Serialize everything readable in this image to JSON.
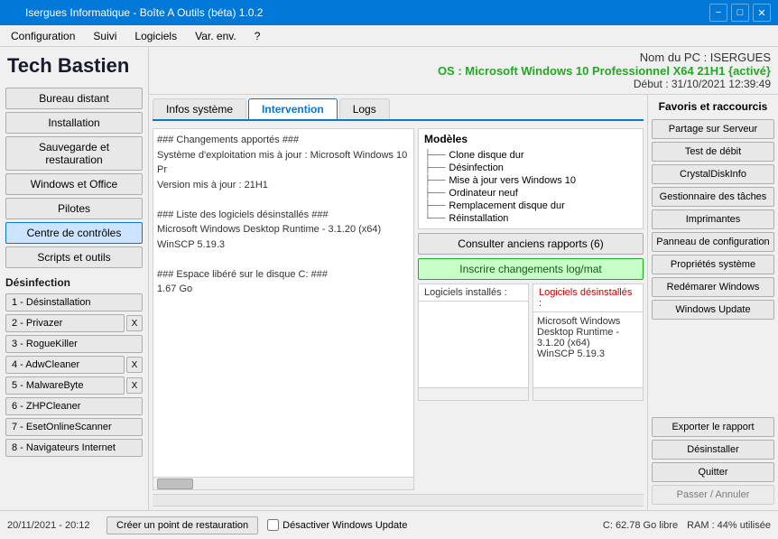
{
  "titlebar": {
    "title": "Isergues Informatique - Boîte A Outils (béta) 1.0.2",
    "minimize": "−",
    "maximize": "□",
    "close": "✕"
  },
  "menubar": {
    "items": [
      "Configuration",
      "Suivi",
      "Logiciels",
      "Var. env.",
      "?"
    ]
  },
  "header": {
    "pc_name": "Nom du PC : ISERGUES",
    "os": "OS : Microsoft Windows 10 Professionnel X64 21H1 {activé}",
    "date": "Début : 31/10/2021 12:39:49"
  },
  "sidebar": {
    "app_title": "Tech Bastien",
    "buttons": [
      "Bureau distant",
      "Installation",
      "Sauvegarde et restauration",
      "Windows et Office",
      "Pilotes"
    ],
    "active_button": "Centre de contrôles",
    "scripts_btn": "Scripts et outils",
    "desinfection_title": "Désinfection",
    "desinfection_items": [
      {
        "label": "1 - Désinstallation",
        "has_x": false
      },
      {
        "label": "2 - Privazer",
        "has_x": true
      },
      {
        "label": "3 - RogueKiller",
        "has_x": false
      },
      {
        "label": "4 - AdwCleaner",
        "has_x": true
      },
      {
        "label": "5 - MalwareByte",
        "has_x": true
      },
      {
        "label": "6 - ZHPCleaner",
        "has_x": false
      },
      {
        "label": "7 - EsetOnlineScanner",
        "has_x": false
      },
      {
        "label": "8 - Navigateurs Internet",
        "has_x": false
      }
    ]
  },
  "tabs": {
    "items": [
      "Infos système",
      "Intervention",
      "Logs"
    ],
    "active": "Intervention"
  },
  "intervention": {
    "changes_content": "### Changements apportés ###\nSystème d'exploitation mis à jour : Microsoft Windows 10 Pr\nVersion mis à jour : 21H1\n\n### Liste des logiciels désinstallés ###\nMicrosoft Windows Desktop Runtime - 3.1.20 (x64)\nWinSCP 5.19.3\n\n### Espace libéré sur le disque C: ###\n1.67 Go",
    "models_title": "Modèles",
    "models": [
      "Clone disque dur",
      "Désinfection",
      "Mise à jour vers Windows 10",
      "Ordinateur neuf",
      "Remplacement disque dur",
      "Réinstallation"
    ],
    "consulter_btn": "Consulter anciens rapports (6)",
    "inscrire_btn": "Inscrire changements log/mat",
    "logiciels_installes_label": "Logiciels installés :",
    "logiciels_desinstalles_label": "Logiciels désinstallés :",
    "logiciels_desinstalles_content": "Microsoft Windows Desktop Runtime - 3.1.20 (x64)\nWinSCP 5.19.3"
  },
  "right_sidebar": {
    "title": "Favoris et raccourcis",
    "buttons": [
      "Partage sur Serveur",
      "Test de débit",
      "CrystalDiskInfo",
      "Gestionnaire des tâches",
      "Imprimantes",
      "Panneau de configuration",
      "Propriétés système",
      "Redémarer Windows",
      "Windows Update"
    ],
    "bottom_buttons": [
      "Exporter le rapport",
      "Désinstaller",
      "Quitter"
    ],
    "passer_btn": "Passer / Annuler"
  },
  "statusbar": {
    "date": "20/11/2021 - 20:12",
    "restore_btn": "Créer un point de restauration",
    "disable_update_label": "Désactiver Windows Update",
    "disk": "C: 62.78 Go libre",
    "ram": "RAM : 44% utilisée"
  }
}
